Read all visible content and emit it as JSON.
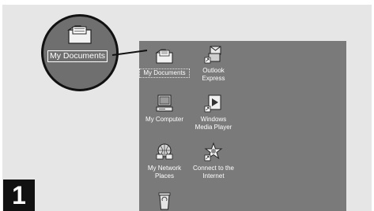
{
  "zoom_label": "My Documents",
  "step_number": "1",
  "desktop_icons": [
    {
      "label": "My Documents",
      "icon": "folder-icon"
    },
    {
      "label": "Outlook\nExpress",
      "icon": "outlook-icon"
    },
    {
      "label": "My Computer",
      "icon": "computer-icon"
    },
    {
      "label": "Windows\nMedia Player",
      "icon": "media-player-icon"
    },
    {
      "label": "My Network\nPlaces",
      "icon": "network-icon"
    },
    {
      "label": "Connect to the\nInternet",
      "icon": "connect-icon"
    },
    {
      "label": "",
      "icon": "recycle-bin-icon"
    }
  ]
}
